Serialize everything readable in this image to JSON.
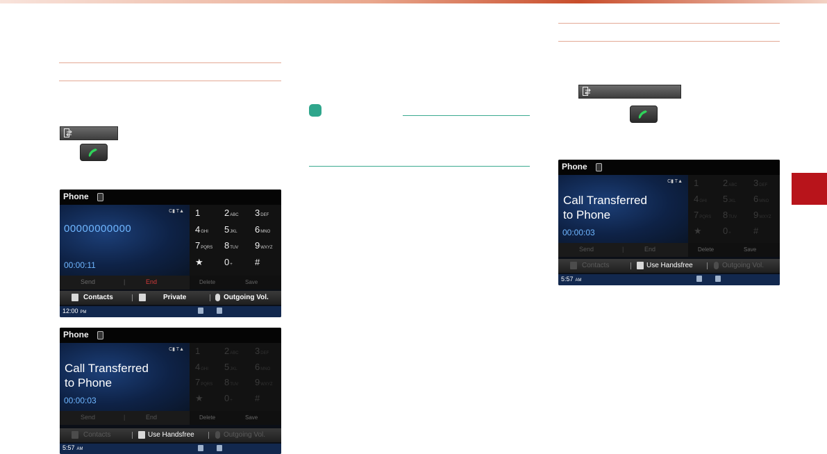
{
  "buttons": {
    "transfer_icon": "transfer-icon",
    "call_icon": "call-handset-icon"
  },
  "colors": {
    "section_rule": "#e3a894",
    "note_rule": "#3aa98f",
    "note_badge": "#2fa68c",
    "chapter_tab": "#b8141b",
    "call_green": "#2fd35a",
    "end_red": "#d23b3b",
    "number_blue": "#6fb6ff"
  },
  "screen_active": {
    "title": "Phone",
    "signal": "C▮ T▲",
    "number": "00000000000",
    "timer": "00:00:11",
    "keys": [
      {
        "d": "1",
        "s": ""
      },
      {
        "d": "2",
        "s": "ABC"
      },
      {
        "d": "3",
        "s": "DEF"
      },
      {
        "d": "4",
        "s": "GHI"
      },
      {
        "d": "5",
        "s": "JKL"
      },
      {
        "d": "6",
        "s": "MNO"
      },
      {
        "d": "7",
        "s": "PQRS"
      },
      {
        "d": "8",
        "s": "TUV"
      },
      {
        "d": "9",
        "s": "WXYZ"
      },
      {
        "d": "★",
        "s": ""
      },
      {
        "d": "0",
        "s": "+"
      },
      {
        "d": "#",
        "s": ""
      }
    ],
    "send": "Send",
    "end": "End",
    "delete": "Delete",
    "save": "Save",
    "menu": [
      "Contacts",
      "Private",
      "Outgoing Vol."
    ],
    "time": "12:00",
    "ampm": "PM"
  },
  "screen_transferred": {
    "title": "Phone",
    "signal": "C▮ T▲",
    "message_line1": "Call Transferred",
    "message_line2": "to Phone",
    "timer": "00:00:03",
    "keys": [
      {
        "d": "1",
        "s": ""
      },
      {
        "d": "2",
        "s": "ABC"
      },
      {
        "d": "3",
        "s": "DEF"
      },
      {
        "d": "4",
        "s": "GHI"
      },
      {
        "d": "5",
        "s": "JKL"
      },
      {
        "d": "6",
        "s": "MNO"
      },
      {
        "d": "7",
        "s": "PQRS"
      },
      {
        "d": "8",
        "s": "TUV"
      },
      {
        "d": "9",
        "s": "WXYZ"
      },
      {
        "d": "★",
        "s": ""
      },
      {
        "d": "0",
        "s": "+"
      },
      {
        "d": "#",
        "s": ""
      }
    ],
    "send": "Send",
    "end": "End",
    "delete": "Delete",
    "save": "Save",
    "menu": [
      "Contacts",
      "Use Handsfree",
      "Outgoing Vol."
    ],
    "time": "5:57",
    "ampm": "AM"
  }
}
